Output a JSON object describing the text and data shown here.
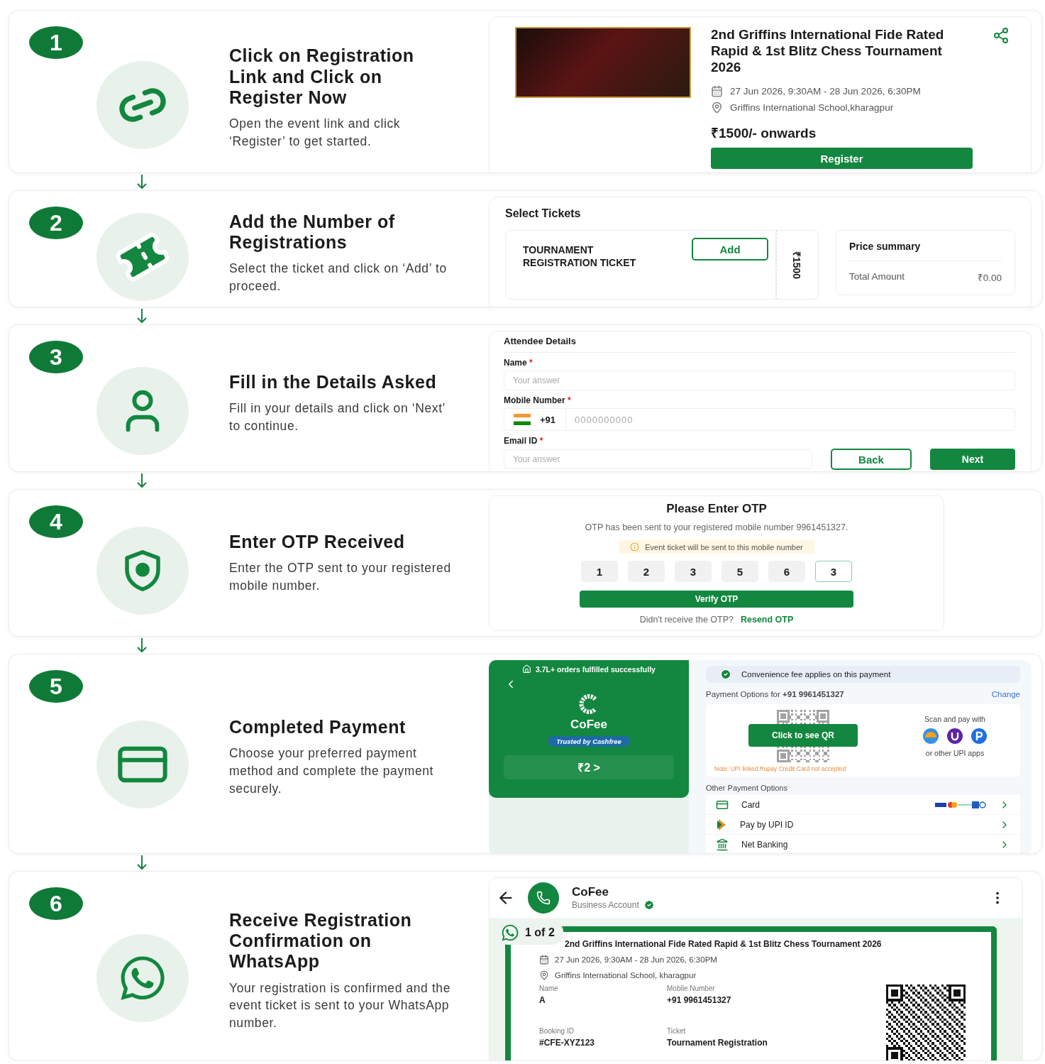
{
  "steps": [
    {
      "number": "1",
      "title": "Click on Registration Link and Click on Register Now",
      "description": "Open the event link and click ‘Register’ to get started.",
      "panel": {
        "kind": "event",
        "title": "2nd Griffins International Fide Rated Rapid & 1st Blitz Chess Tournament 2026",
        "date": "27 Jun 2026, 9:30AM - 28 Jun 2026, 6:30PM",
        "venue": "Griffins International School,kharagpur",
        "price": "₹1500/- onwards",
        "button": "Register"
      }
    },
    {
      "number": "2",
      "title": "Add the Number of Registrations",
      "description": "Select the ticket and click on ‘Add’ to proceed.",
      "panel": {
        "kind": "tickets",
        "heading": "Select Tickets",
        "ticket": "TOURNAMENT REGISTRATION TICKET",
        "button": "Add",
        "ticket_price": "₹1500",
        "summary_heading": "Price summary",
        "total_label": "Total Amount",
        "total": "₹0.00"
      }
    },
    {
      "number": "3",
      "title": "Fill in the Details Asked",
      "description": "Fill in your details and click on ‘Next’ to continue.",
      "panel": {
        "kind": "form",
        "heading": "Attendee Details",
        "fields": [
          {
            "kind": "text",
            "label": "Name",
            "required_mark": "*",
            "placeholder": "Your answer"
          },
          {
            "kind": "phone",
            "label": "Mobile Number",
            "required_mark": "*",
            "code": "+91",
            "placeholder": "0000000000"
          },
          {
            "kind": "text",
            "label": "Email ID",
            "required_mark": "*",
            "placeholder": "Your answer"
          }
        ],
        "back": "Back",
        "next": "Next"
      }
    },
    {
      "number": "4",
      "title": "Enter OTP Received",
      "description": "Enter the OTP sent to your registered mobile number.",
      "panel": {
        "kind": "otp",
        "heading": "Please Enter OTP",
        "message": "OTP has been sent to your registered mobile number 9961451327.",
        "notice": "Event ticket will be sent to this mobile number",
        "digits": [
          {
            "value": "1",
            "selected": false
          },
          {
            "value": "2",
            "selected": false
          },
          {
            "value": "3",
            "selected": false
          },
          {
            "value": "5",
            "selected": false
          },
          {
            "value": "6",
            "selected": false
          },
          {
            "value": "3",
            "selected": true
          }
        ],
        "button": "Verify OTP",
        "resend_prompt": "Didn't receive the OTP?",
        "resend": "Resend OTP"
      }
    },
    {
      "number": "5",
      "title": "Completed Payment",
      "description": "Choose your preferred payment method and complete the payment securely.",
      "panel": {
        "kind": "payment",
        "orders": "3.7L+ orders fulfilled successfully",
        "brand": "CoFee",
        "trust": "Trusted by Cashfree",
        "amount": "₹2 >",
        "notice": "Convenience fee applies on this payment",
        "options_for": "Payment Options for **+91 9961451327**",
        "change": "Change",
        "qr_button": "Click to see QR",
        "scan": "Scan and pay with",
        "other_apps": "or other UPI apps",
        "note": "Note: UPI linked Rupay Credit Card not accepted",
        "other_heading": "Other Payment Options",
        "options": [
          {
            "kind": "card",
            "label": "Card"
          },
          {
            "kind": "upi",
            "label": "Pay by UPI ID"
          },
          {
            "kind": "bank",
            "label": "Net Banking"
          }
        ]
      }
    },
    {
      "number": "6",
      "title": "Receive Registration Confirmation on WhatsApp",
      "description": "Your registration is confirmed and the event ticket is sent to your WhatsApp number.",
      "panel": {
        "kind": "whatsapp",
        "name": "CoFee",
        "subtitle": "Business Account",
        "counter": "1 of 2",
        "title": "2nd Griffins International Fide Rated Rapid & 1st Blitz Chess Tournament 2026",
        "date": "27 Jun 2026, 9:30AM - 28 Jun 2026, 6:30PM",
        "venue": "Griffins International School, kharagpur",
        "details": [
          {
            "label": "Name",
            "value": "A"
          },
          {
            "label": "Mobile Number",
            "value": "+91 9961451327"
          },
          {
            "label": "Booking ID",
            "value": "#CFE-XYZ123"
          },
          {
            "label": "Ticket",
            "value": "Tournament Registration"
          }
        ]
      }
    }
  ]
}
